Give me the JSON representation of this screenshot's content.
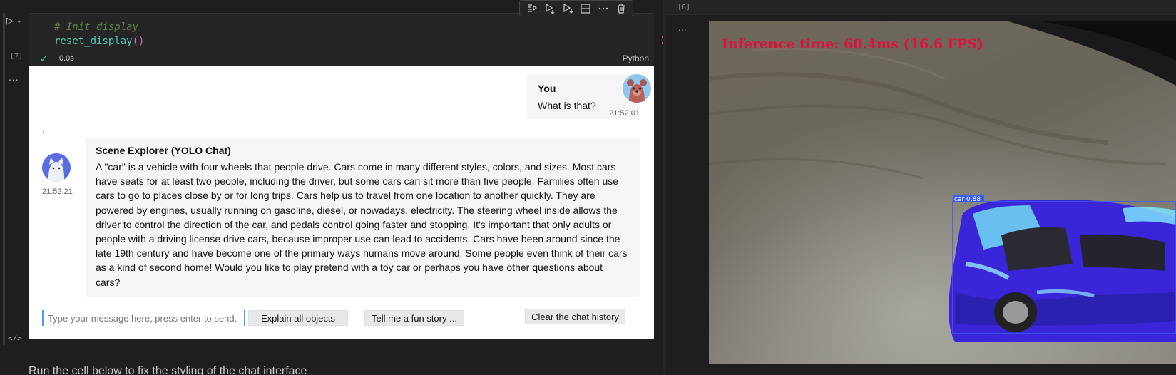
{
  "left_cell": {
    "exec_count": "[7]",
    "code_comment": "# Init display",
    "code_fn": "reset_display",
    "code_parens": "()",
    "status_time": "0.0s",
    "language": "Python",
    "output_ellipsis": "...",
    "code_icon": "</>"
  },
  "toolbar": {
    "icons": [
      "execute-above-icon",
      "run-below-icon",
      "run-next-icon",
      "split-cell-icon",
      "more-icon",
      "delete-icon"
    ]
  },
  "chat": {
    "user": {
      "name": "You",
      "text": "What is that?",
      "time": "21:52:01"
    },
    "bot": {
      "name": "Scene Explorer (YOLO Chat)",
      "text": "A \"car\" is a vehicle with four wheels that people drive. Cars come in many different styles, colors, and sizes. Most cars have seats for at least two people, including the driver, but some cars can sit more than five people. Families often use cars to go to places close by or for long trips. Cars help us to travel from one location to another quickly. They are powered by engines, usually running on gasoline, diesel, or nowadays, electricity. The steering wheel inside allows the driver to control the direction of the car, and pedals control going faster and stopping. It's important that only adults or people with a driving license drive cars, because improper use can lead to accidents. Cars have been around since the late 19th century and have become one of the primary ways humans move around. Some people even think of their cars as a kind of second home! Would you like to play pretend with a toy car or perhaps you have other questions about cars?",
      "time": "21:52:21"
    },
    "input_placeholder": "Type your message here, press enter to send.",
    "buttons": {
      "explain": "Explain all objects",
      "story": "Tell me a fun story ...",
      "clear": "Clear the chat history"
    }
  },
  "below_text": "Run the cell below to fix the styling of the chat interface",
  "right_cell": {
    "exec_count": "[6]",
    "output_ellipsis": "...",
    "inference_text": "Inference time: 60.4ms (16.6 FPS)",
    "detection_label": "car 0.88"
  },
  "colors": {
    "inference_text": "#e0103a",
    "box": "#3a5cf0",
    "car_body": "#3a25d8",
    "accent": "#4ec98a"
  }
}
